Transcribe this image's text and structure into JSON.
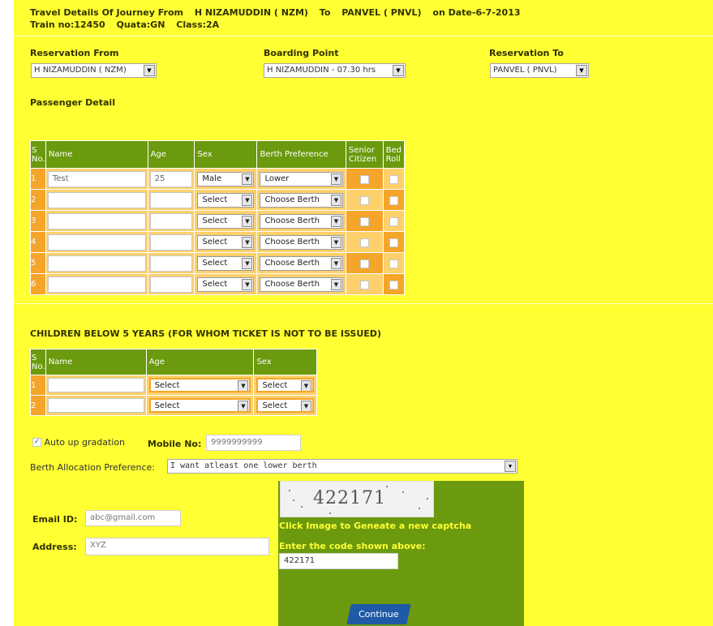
{
  "header": {
    "travel_label": "Travel Details Of Journey From",
    "from": "H NIZAMUDDIN ( NZM)",
    "to_word": "To",
    "to": "PANVEL ( PNVL)",
    "date": "on Date-6-7-2013",
    "train": "Train no:12450",
    "quota": "Quata:GN",
    "class": "Class:2A"
  },
  "reservation": {
    "from_label": "Reservation From",
    "from_value": "H NIZAMUDDIN ( NZM)",
    "boarding_label": "Boarding Point",
    "boarding_value": "H NIZAMUDDIN - 07.30 hrs",
    "to_label": "Reservation To",
    "to_value": "PANVEL ( PNVL)"
  },
  "passenger": {
    "section_title": "Passenger Detail",
    "headers": {
      "sno": "S No.",
      "name": "Name",
      "age": "Age",
      "sex": "Sex",
      "berth": "Berth Preference",
      "senior": "Senior Citizen",
      "bedroll": "Bed Roll"
    },
    "rows": [
      {
        "sno": "1",
        "name": "Test",
        "age": "25",
        "sex": "Male",
        "berth": "Lower"
      },
      {
        "sno": "2",
        "name": "",
        "age": "",
        "sex": "Select",
        "berth": "Choose Berth"
      },
      {
        "sno": "3",
        "name": "",
        "age": "",
        "sex": "Select",
        "berth": "Choose Berth"
      },
      {
        "sno": "4",
        "name": "",
        "age": "",
        "sex": "Select",
        "berth": "Choose Berth"
      },
      {
        "sno": "5",
        "name": "",
        "age": "",
        "sex": "Select",
        "berth": "Choose Berth"
      },
      {
        "sno": "6",
        "name": "",
        "age": "",
        "sex": "Select",
        "berth": "Choose Berth"
      }
    ]
  },
  "children": {
    "section_title": "CHILDREN BELOW 5 YEARS (FOR WHOM TICKET IS NOT TO BE ISSUED)",
    "headers": {
      "sno": "S No.",
      "name": "Name",
      "age": "Age",
      "sex": "Sex"
    },
    "rows": [
      {
        "sno": "1",
        "name": "",
        "age": "Select",
        "sex": "Select"
      },
      {
        "sno": "2",
        "name": "",
        "age": "Select",
        "sex": "Select"
      }
    ]
  },
  "options": {
    "auto_upgrade_label": "Auto up gradation",
    "auto_upgrade_checked": true,
    "mobile_label": "Mobile No:",
    "mobile_value": "9999999999",
    "berth_alloc_label": "Berth Allocation Preference:",
    "berth_alloc_value": "I want atleast one lower berth"
  },
  "contact": {
    "email_label": "Email ID:",
    "email_value": "abc@gmail.com",
    "address_label": "Address:",
    "address_value": "XYZ"
  },
  "captcha": {
    "image_text": "422171",
    "regenerate_label": "Click Image to Geneate a new captcha",
    "enter_label": "Enter the code shown above:",
    "code_value": "422171"
  },
  "buttons": {
    "continue": "Continue"
  },
  "colors": {
    "page_bg": "#ffff33",
    "header_green": "#6b9a0e",
    "orange": "#f5a52a",
    "button_blue": "#1f5aa6"
  }
}
